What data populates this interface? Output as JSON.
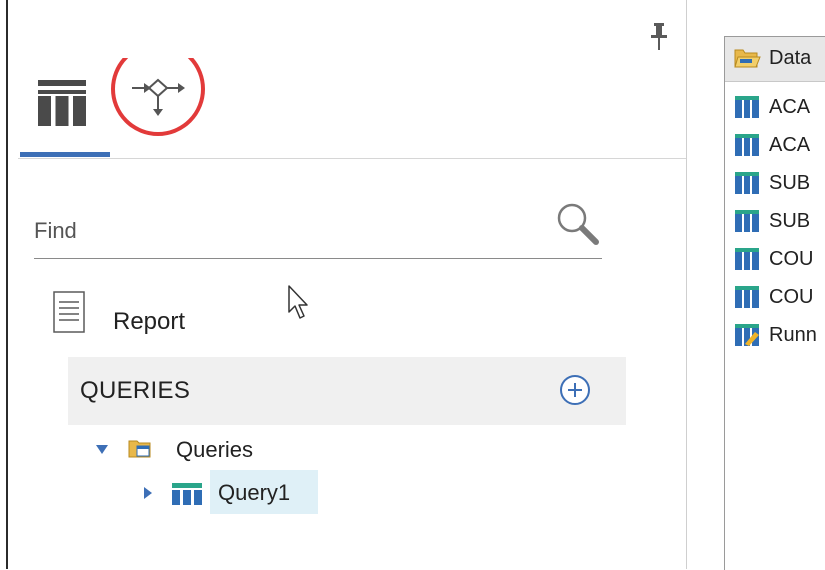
{
  "toolbar": {
    "pin_icon": "pin-icon"
  },
  "tabs": [
    {
      "icon": "table-icon",
      "active": true
    },
    {
      "icon": "query-flow-icon",
      "active": false,
      "highlight_ring_color": "#e23a3a"
    }
  ],
  "search": {
    "label": "Find",
    "value": "",
    "icon": "search-icon"
  },
  "tree": {
    "report_label": "Report",
    "queries_header": "QUERIES",
    "queries_folder": "Queries",
    "query_item": "Query1"
  },
  "right_panel": {
    "header": "Data",
    "items": [
      {
        "label": "ACA",
        "icon": "table-icon"
      },
      {
        "label": "ACA",
        "icon": "table-icon"
      },
      {
        "label": "SUB",
        "icon": "table-icon"
      },
      {
        "label": "SUB",
        "icon": "table-icon"
      },
      {
        "label": "COU",
        "icon": "table-icon"
      },
      {
        "label": "COU",
        "icon": "table-icon"
      },
      {
        "label": "Runn",
        "icon": "table-edit-icon"
      }
    ]
  },
  "colors": {
    "accent": "#3d6fb6",
    "highlight_ring": "#e23a3a",
    "selected_row": "#dff0f7",
    "table_icon_blue": "#2f6db5",
    "table_icon_teal": "#2aa58a"
  }
}
